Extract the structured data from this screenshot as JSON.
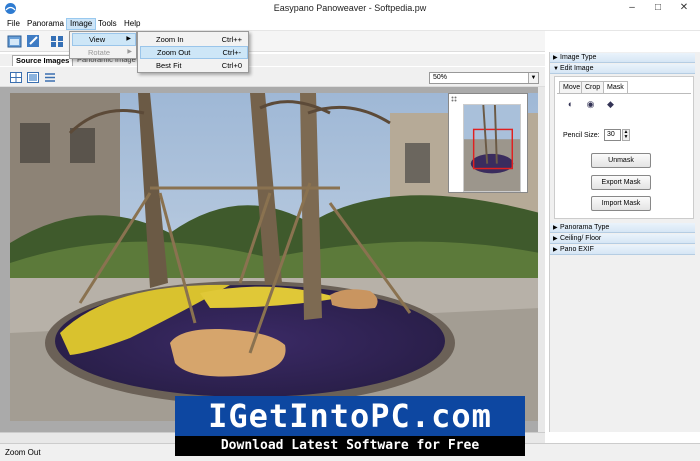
{
  "window": {
    "title": "Easypano Panoweaver - Softpedia.pw",
    "minimize": "–",
    "maximize": "□",
    "close": "✕"
  },
  "menubar": [
    "File",
    "Panorama",
    "Image",
    "Tools",
    "Help"
  ],
  "tabs": [
    "Source Images",
    "Panoramic Image"
  ],
  "zoom": {
    "value": "50%"
  },
  "image_menu": {
    "items": [
      {
        "label": "View",
        "has_submenu": true,
        "highlighted": true,
        "enabled": true
      },
      {
        "label": "Rotate",
        "has_submenu": true,
        "highlighted": false,
        "enabled": false
      }
    ]
  },
  "view_submenu": {
    "items": [
      {
        "label": "Zoom In",
        "shortcut": "Ctrl++"
      },
      {
        "label": "Zoom Out",
        "shortcut": "Ctrl+-"
      },
      {
        "label": "Best Fit",
        "shortcut": "Ctrl+0"
      }
    ]
  },
  "right_panel": {
    "sections_top": [
      "Image Type",
      "Edit Image"
    ],
    "subtabs": [
      "Move",
      "Crop",
      "Mask"
    ],
    "pencil_label": "Pencil Size:",
    "pencil_value": "30",
    "buttons": [
      "Unmask",
      "Export Mask",
      "Import Mask"
    ],
    "sections_bottom": [
      "Panorama Type",
      "Ceiling/ Floor",
      "Pano EXIF"
    ]
  },
  "status": {
    "text": "Zoom Out"
  },
  "watermark": {
    "top": "IGetIntoPC.com",
    "bottom": "Download Latest Software for Free"
  }
}
